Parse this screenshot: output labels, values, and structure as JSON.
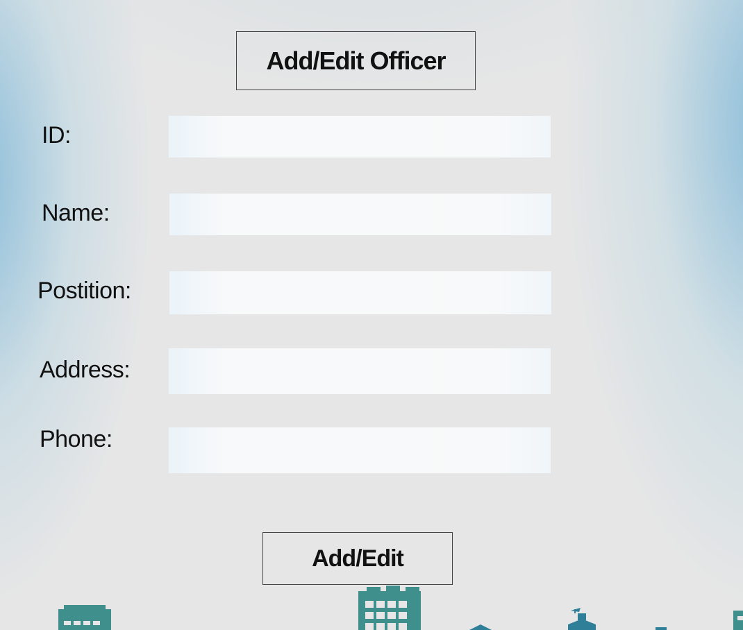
{
  "header": {
    "title": "Add/Edit Officer"
  },
  "form": {
    "fields": [
      {
        "label": "ID:",
        "value": ""
      },
      {
        "label": "Name:",
        "value": ""
      },
      {
        "label": "Postition:",
        "value": ""
      },
      {
        "label": "Address:",
        "value": ""
      },
      {
        "label": "Phone:",
        "value": ""
      }
    ],
    "submit_label": "Add/Edit"
  },
  "colors": {
    "background": "#e6e6e6",
    "accent_blue": "#78b4d7",
    "building_teal": "#3f8f8c",
    "building_blue": "#2f7f99"
  },
  "decor": {
    "icons": [
      "building-icon",
      "office-tower-icon",
      "house-icon",
      "school-icon"
    ]
  }
}
